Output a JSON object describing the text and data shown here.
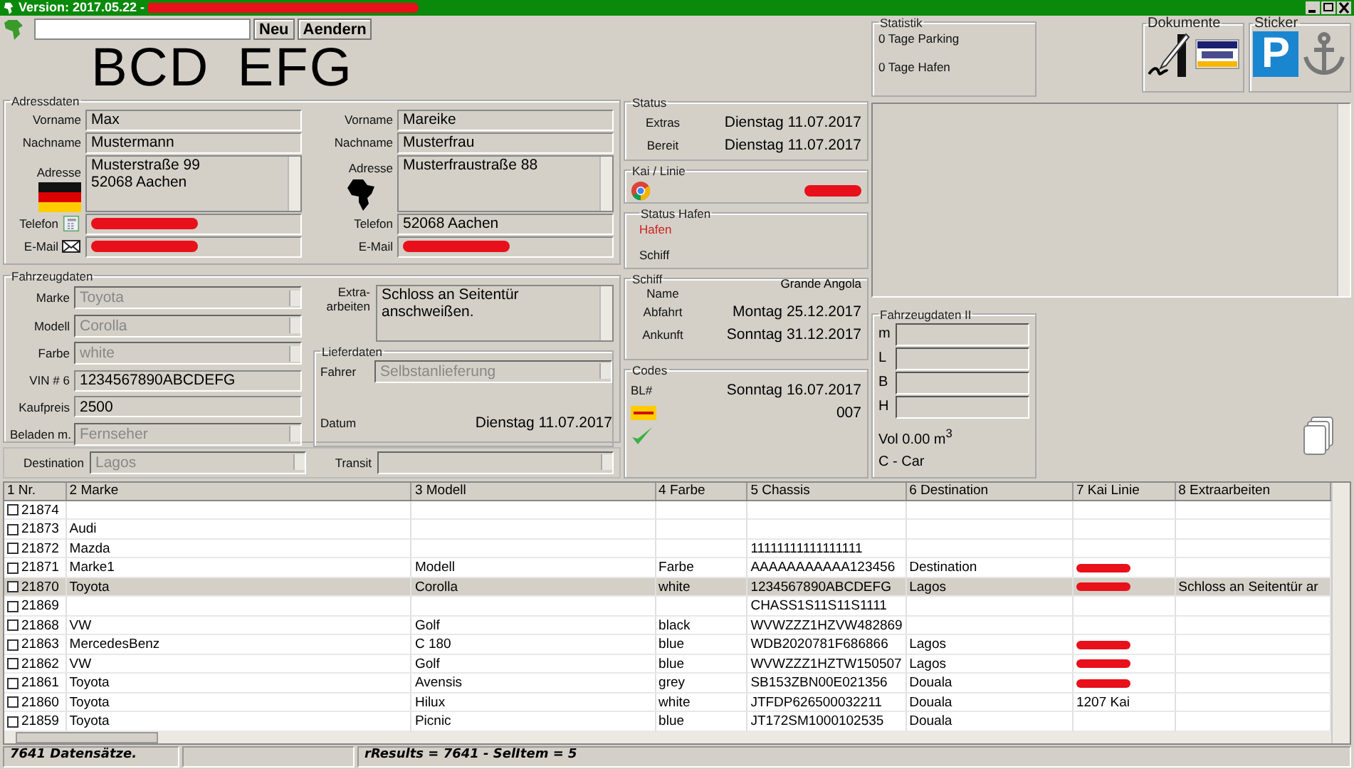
{
  "window": {
    "title": "Version: 2017.05.22 -",
    "title_redacted": true
  },
  "toolbar": {
    "buttons": [
      {
        "label": "Neu"
      },
      {
        "label": "Aendern"
      }
    ]
  },
  "plate": "BCD EFG",
  "address": {
    "title": "Adressdaten",
    "persons": [
      {
        "fields": [
          {
            "kind": "text",
            "label": "Vorname",
            "value": "Max"
          },
          {
            "kind": "text",
            "label": "Nachname",
            "value": "Mustermann"
          },
          {
            "kind": "area",
            "label": "Adresse",
            "lines": [
              "Musterstraße 99",
              "52068 Aachen"
            ]
          },
          {
            "kind": "text",
            "label": "Telefon",
            "redacted": true
          },
          {
            "kind": "text",
            "label": "E-Mail",
            "redacted": true
          }
        ]
      },
      {
        "fields": [
          {
            "kind": "text",
            "label": "Vorname",
            "value": "Mareike"
          },
          {
            "kind": "text",
            "label": "Nachname",
            "value": "Musterfrau"
          },
          {
            "kind": "area",
            "label": "Adresse",
            "lines": [
              "Musterfraustraße 88"
            ]
          },
          {
            "kind": "text",
            "label": "Telefon",
            "value": "52068 Aachen"
          },
          {
            "kind": "text",
            "label": "E-Mail",
            "redacted": true
          }
        ]
      }
    ]
  },
  "vehicle": {
    "title": "Fahrzeugdaten",
    "fields": [
      {
        "kind": "combo",
        "label": "Marke",
        "value": "Toyota",
        "disabled": true
      },
      {
        "kind": "combo",
        "label": "Modell",
        "value": "Corolla",
        "disabled": true
      },
      {
        "kind": "combo",
        "label": "Farbe",
        "value": "white",
        "disabled": true
      },
      {
        "kind": "text",
        "label": "VIN # 6",
        "value": "1234567890ABCDEFG"
      },
      {
        "kind": "text",
        "label": "Kaufpreis",
        "value": "2500"
      },
      {
        "kind": "combo",
        "label": "Beladen m.",
        "value": "Fernseher",
        "disabled": true
      }
    ],
    "extra": {
      "label": "Extra-\narbeiten",
      "value": "Schloss an Seitentür anschweißen."
    },
    "delivery": {
      "title": "Lieferdaten",
      "driver_label": "Fahrer",
      "driver": "Selbstanlieferung",
      "driver_disabled": true,
      "date_label": "Datum",
      "date": "Dienstag 11.07.2017"
    }
  },
  "route": [
    {
      "label": "Destination",
      "value": "Lagos",
      "disabled": true
    },
    {
      "label": "Transit"
    }
  ],
  "status": {
    "title": "Status",
    "rows": [
      {
        "label": "Extras",
        "value": "Dienstag 11.07.2017"
      },
      {
        "label": "Bereit",
        "value": "Dienstag 11.07.2017"
      }
    ]
  },
  "kai": {
    "title": "Kai / Linie",
    "redacted": true
  },
  "harbor_status": {
    "title": "Status Hafen",
    "items": [
      {
        "label": "Hafen",
        "selected": true
      },
      {
        "label": "Schiff",
        "selected": false
      }
    ]
  },
  "ship": {
    "title": "Schiff",
    "name_value": "Grande Angola",
    "name_label": "Name",
    "rows": [
      {
        "label": "Abfahrt",
        "value": "Montag 25.12.2017"
      },
      {
        "label": "Ankunft",
        "value": "Sonntag 31.12.2017"
      }
    ]
  },
  "codes": {
    "title": "Codes",
    "bl_label": "BL#",
    "bl_date": "Sonntag 16.07.2017",
    "dhl_code": "007",
    "confirmed": true
  },
  "statistics": {
    "title": "Statistik",
    "lines": [
      "0 Tage Parking",
      "0 Tage Hafen"
    ]
  },
  "documents": {
    "title": "Dokumente"
  },
  "stickers": {
    "title": "Sticker",
    "items": [
      {
        "kind": "parking",
        "label": "P"
      },
      {
        "kind": "anchor"
      }
    ]
  },
  "vehicle2": {
    "title": "Fahrzeugdaten II",
    "fields": [
      "m",
      "L",
      "B",
      "H"
    ],
    "volume": "Vol 0.00 m$^{3}$",
    "category": "C - Car"
  },
  "table": {
    "columns": [
      "1 Nr.",
      "2 Marke",
      "3 Modell",
      "4 Farbe",
      "5 Chassis",
      "6 Destination",
      "7 Kai Linie",
      "8 Extraarbeiten"
    ],
    "rows": [
      {
        "cells": [
          "21874",
          "",
          "",
          "",
          "",
          "",
          "",
          ""
        ],
        "selected": false,
        "checked": false
      },
      {
        "cells": [
          "21873",
          "Audi",
          "",
          "",
          "",
          "",
          "",
          ""
        ],
        "selected": false,
        "checked": false
      },
      {
        "cells": [
          "21872",
          "Mazda",
          "",
          "",
          "11111111111111111",
          "",
          "",
          ""
        ],
        "selected": false,
        "checked": false
      },
      {
        "cells": [
          "21871",
          "Marke1",
          "Modell",
          "Farbe",
          "AAAAAAAAAAA123456",
          "Destination",
          "",
          ""
        ],
        "kai_redacted": true,
        "selected": false,
        "checked": false
      },
      {
        "cells": [
          "21870",
          "Toyota",
          "Corolla",
          "white",
          "1234567890ABCDEFG",
          "Lagos",
          "",
          "Schloss an Seitentür ar"
        ],
        "kai_redacted": true,
        "selected": true,
        "checked": false
      },
      {
        "cells": [
          "21869",
          "",
          "",
          "",
          "CHASS1S11S11S1111",
          "",
          "",
          ""
        ],
        "selected": false,
        "checked": false
      },
      {
        "cells": [
          "21868",
          "VW",
          "Golf",
          "black",
          "WVWZZZ1HZVW482869",
          "",
          "",
          ""
        ],
        "selected": false,
        "checked": false
      },
      {
        "cells": [
          "21863",
          "MercedesBenz",
          "C 180",
          "blue",
          "WDB2020781F686866",
          "Lagos",
          "",
          ""
        ],
        "kai_redacted": true,
        "selected": false,
        "checked": false
      },
      {
        "cells": [
          "21862",
          "VW",
          "Golf",
          "blue",
          "WVWZZZ1HZTW150507",
          "Lagos",
          "",
          ""
        ],
        "kai_redacted": true,
        "selected": false,
        "checked": false
      },
      {
        "cells": [
          "21861",
          "Toyota",
          "Avensis",
          "grey",
          "SB153ZBN00E021356",
          "Douala",
          "",
          ""
        ],
        "kai_redacted": true,
        "selected": false,
        "checked": false
      },
      {
        "cells": [
          "21860",
          "Toyota",
          "Hilux",
          "white",
          "JTFDP626500032211",
          "Douala",
          "1207 Kai",
          ""
        ],
        "selected": false,
        "checked": false
      },
      {
        "cells": [
          "21859",
          "Toyota",
          "Picnic",
          "blue",
          "JT172SM1000102535",
          "Douala",
          "",
          ""
        ],
        "selected": false,
        "checked": false
      }
    ]
  },
  "status_bar": [
    "7641 Datensätze.",
    "rResults = 7641  -  SelItem = 5"
  ]
}
